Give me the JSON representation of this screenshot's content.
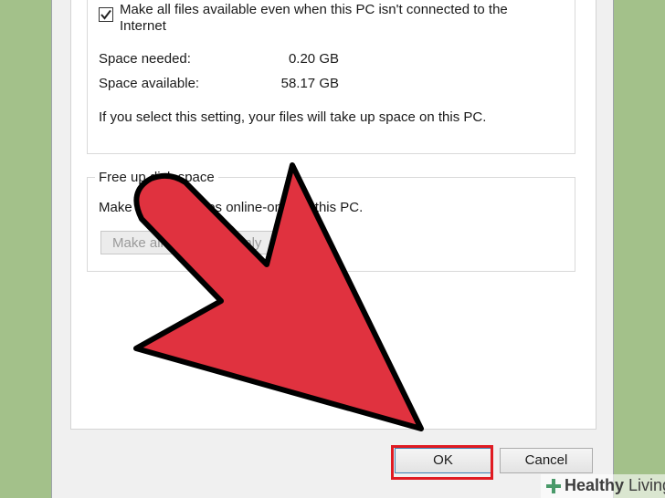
{
  "offline_group": {
    "checkbox_label": "Make all files available even when this PC isn't connected to the Internet",
    "checked": true,
    "space_needed_label": "Space needed:",
    "space_needed_value": "0.20 GB",
    "space_available_label": "Space available:",
    "space_available_value": "58.17 GB",
    "note": "If you select this setting, your files will take up space on this PC."
  },
  "free_space_group": {
    "title": "Free up disk space",
    "description": "Make OneDrive files online-only on this PC.",
    "button_label": "Make all files online-only"
  },
  "buttons": {
    "ok_label": "OK",
    "cancel_label": "Cancel"
  },
  "annotation": {
    "arrow_color": "#e0323f",
    "highlight_color": "#e01b22"
  },
  "watermark": {
    "brand_bold": "Healthy",
    "brand_light": " Living"
  }
}
